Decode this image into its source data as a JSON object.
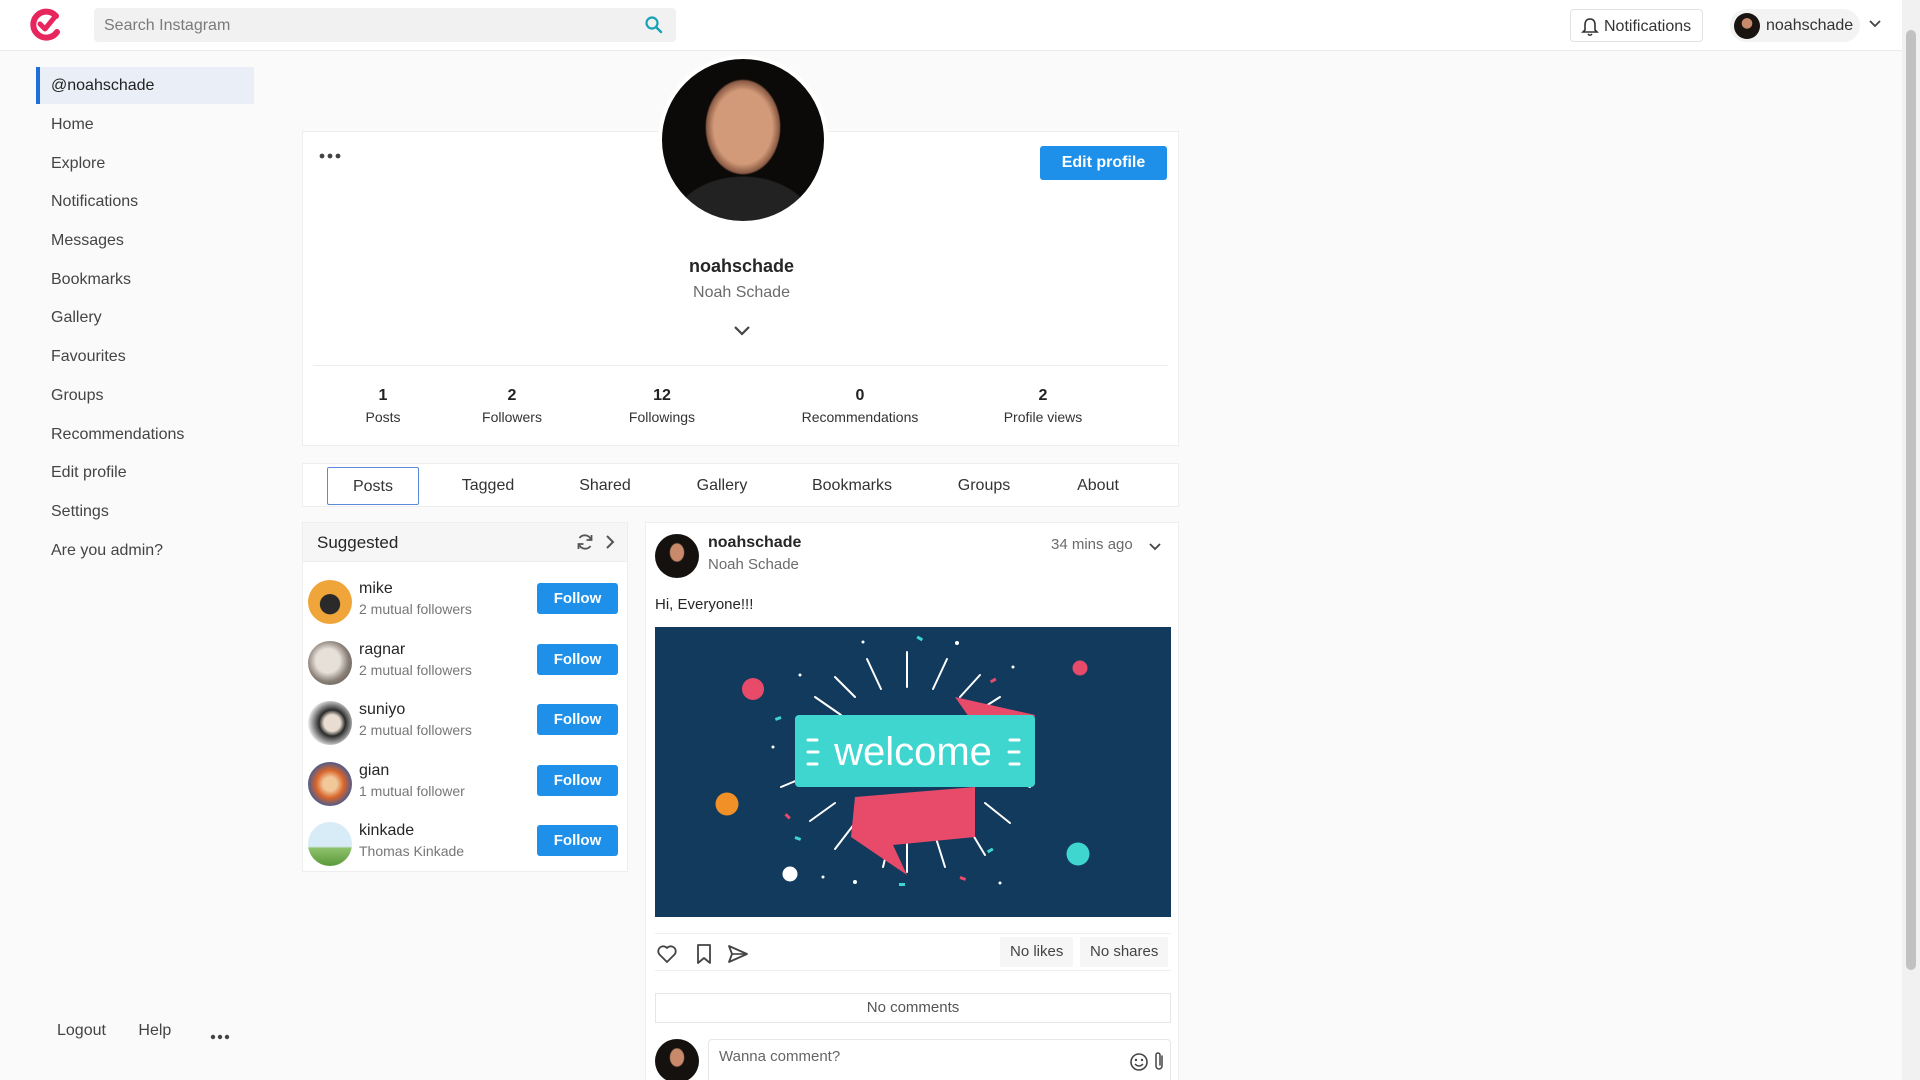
{
  "header": {
    "search_placeholder": "Search Instagram",
    "notifications_label": "Notifications",
    "user_label": "noahschade",
    "brand_color": "#e8265e",
    "accent_color": "#1e90ea"
  },
  "sidebar": {
    "items": [
      {
        "label": "@noahschade",
        "active": true
      },
      {
        "label": "Home"
      },
      {
        "label": "Explore"
      },
      {
        "label": "Notifications"
      },
      {
        "label": "Messages"
      },
      {
        "label": "Bookmarks"
      },
      {
        "label": "Gallery"
      },
      {
        "label": "Favourites"
      },
      {
        "label": "Groups"
      },
      {
        "label": "Recommendations"
      },
      {
        "label": "Edit profile"
      },
      {
        "label": "Settings"
      },
      {
        "label": "Are you admin?"
      }
    ],
    "footer": {
      "logout": "Logout",
      "help": "Help"
    }
  },
  "profile": {
    "username": "noahschade",
    "full_name": "Noah Schade",
    "edit_label": "Edit profile",
    "stats": [
      {
        "value": "1",
        "label": "Posts"
      },
      {
        "value": "2",
        "label": "Followers"
      },
      {
        "value": "12",
        "label": "Followings"
      },
      {
        "value": "0",
        "label": "Recommendations"
      },
      {
        "value": "2",
        "label": "Profile views"
      }
    ]
  },
  "tabs": [
    "Posts",
    "Tagged",
    "Shared",
    "Gallery",
    "Bookmarks",
    "Groups",
    "About"
  ],
  "active_tab": "Posts",
  "suggested": {
    "title": "Suggested",
    "follow_label": "Follow",
    "users": [
      {
        "name": "mike",
        "sub": "2 mutual followers"
      },
      {
        "name": "ragnar",
        "sub": "2 mutual followers"
      },
      {
        "name": "suniyo",
        "sub": "2 mutual followers"
      },
      {
        "name": "gian",
        "sub": "1 mutual follower"
      },
      {
        "name": "kinkade",
        "sub": "Thomas Kinkade"
      }
    ]
  },
  "post": {
    "username": "noahschade",
    "full_name": "Noah Schade",
    "time": "34 mins ago",
    "text": "Hi, Everyone!!!",
    "image_text": "welcome",
    "likes": "No likes",
    "shares": "No shares",
    "comments": "No comments",
    "comment_placeholder": "Wanna comment?"
  }
}
